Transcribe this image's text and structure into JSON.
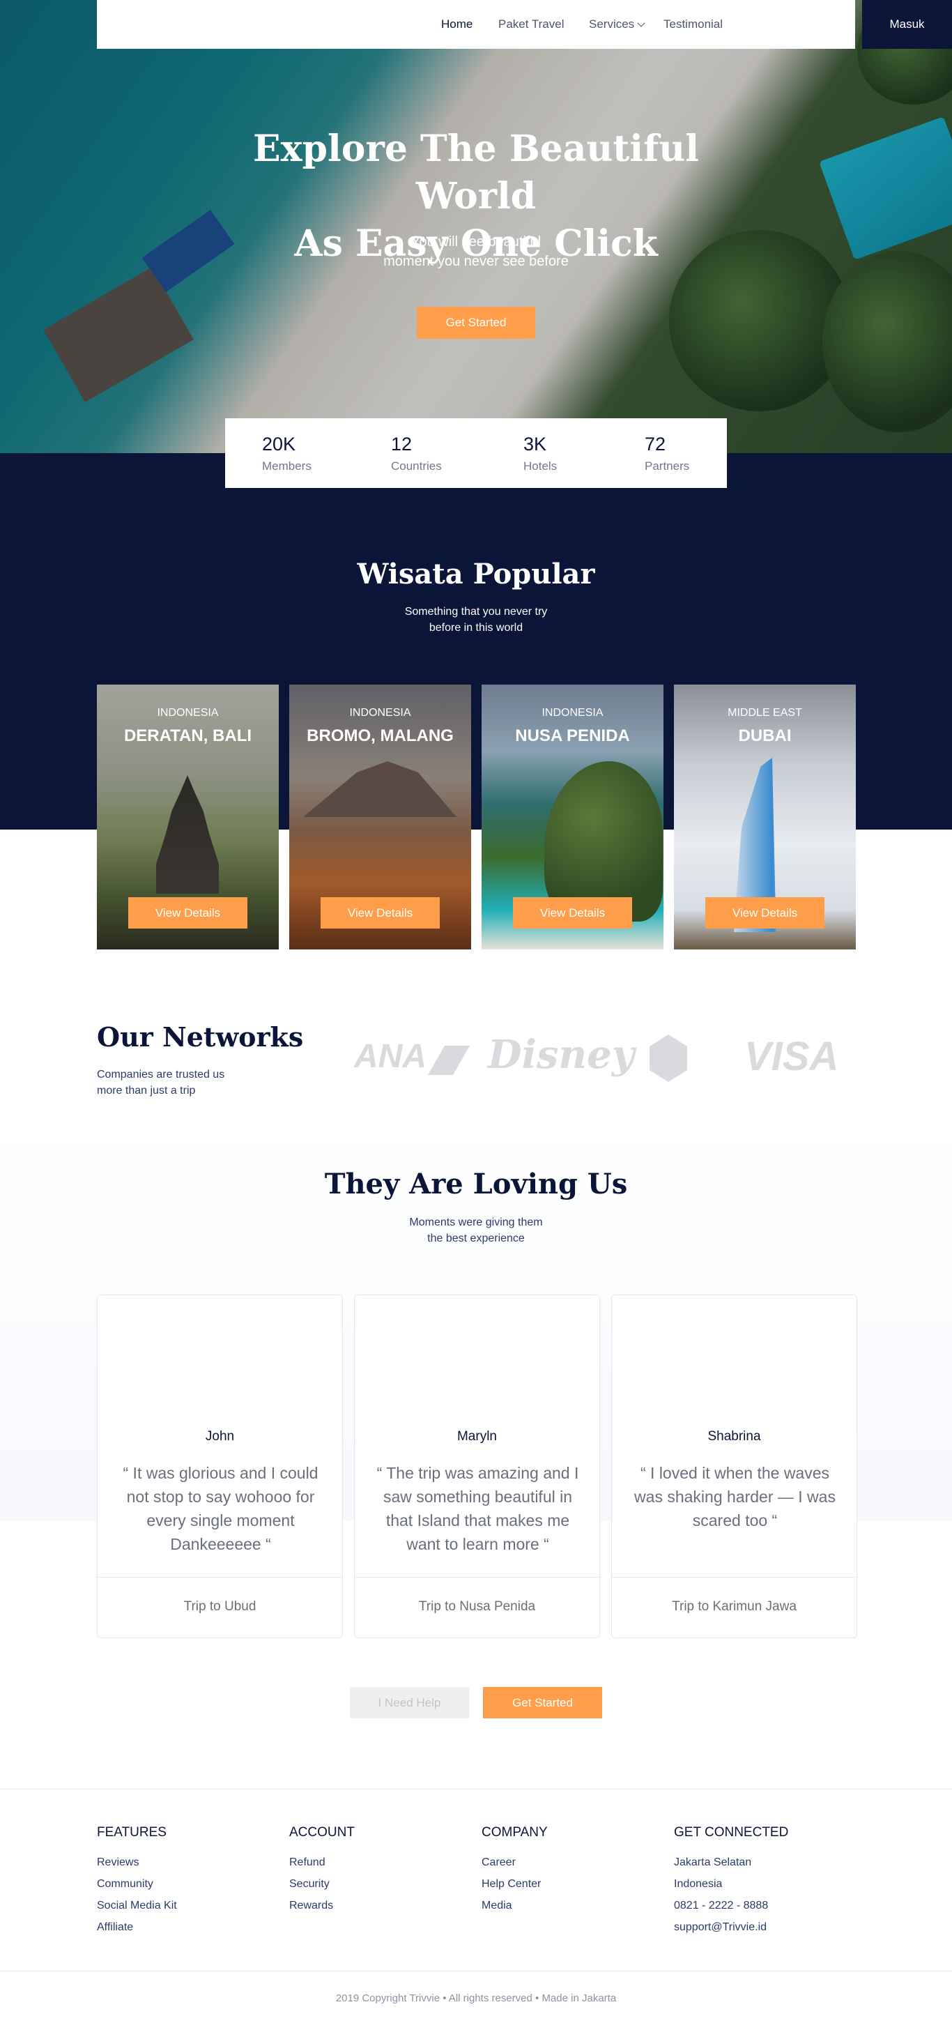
{
  "nav": {
    "items": [
      "Home",
      "Paket Travel",
      "Services",
      "Testimonial"
    ],
    "login_label": "Masuk"
  },
  "hero": {
    "title_line1": "Explore The Beautiful World",
    "title_line2": "As Easy One Click",
    "subtitle_line1": "You will see beautiful",
    "subtitle_line2": "moment you never see before",
    "cta_label": "Get Started"
  },
  "stats": [
    {
      "value": "20K",
      "label": "Members"
    },
    {
      "value": "12",
      "label": "Countries"
    },
    {
      "value": "3K",
      "label": "Hotels"
    },
    {
      "value": "72",
      "label": "Partners"
    }
  ],
  "popular": {
    "title": "Wisata Popular",
    "subtitle_line1": "Something that you never try",
    "subtitle_line2": "before in this world",
    "button_label": "View Details",
    "cards": [
      {
        "country": "INDONESIA",
        "place": "DERATAN, BALI"
      },
      {
        "country": "INDONESIA",
        "place": "BROMO, MALANG"
      },
      {
        "country": "INDONESIA",
        "place": "NUSA PENIDA"
      },
      {
        "country": "MIDDLE EAST",
        "place": "DUBAI"
      }
    ]
  },
  "networks": {
    "title": "Our Networks",
    "subtitle_line1": "Companies are trusted us",
    "subtitle_line2": "more than just a trip",
    "logos": [
      "ANA",
      "Disney",
      "VISA"
    ]
  },
  "testimonials": {
    "title": "They Are Loving Us",
    "subtitle_line1": "Moments were giving them",
    "subtitle_line2": "the best experience",
    "items": [
      {
        "name": "John",
        "quote": "“ It was glorious and I could not stop to say wohooo for every single moment Dankeeeeee “",
        "trip": "Trip to Ubud"
      },
      {
        "name": "Maryln",
        "quote": "“ The trip was amazing and I saw something beautiful in that Island that makes me want to learn more “",
        "trip": "Trip to Nusa Penida"
      },
      {
        "name": "Shabrina",
        "quote": "“ I loved it when the waves was shaking harder — I was scared too “",
        "trip": "Trip to Karimun Jawa"
      }
    ],
    "help_label": "I Need Help",
    "cta_label": "Get Started"
  },
  "footer": {
    "columns": [
      {
        "heading": "FEATURES",
        "links": [
          "Reviews",
          "Community",
          "Social Media Kit",
          "Affiliate"
        ]
      },
      {
        "heading": "ACCOUNT",
        "links": [
          "Refund",
          "Security",
          "Rewards"
        ]
      },
      {
        "heading": "COMPANY",
        "links": [
          "Career",
          "Help Center",
          "Media"
        ]
      },
      {
        "heading": "GET CONNECTED",
        "links": [
          "Jakarta Selatan",
          "Indonesia",
          "0821 - 2222 - 8888",
          "support@Trivvie.id"
        ]
      }
    ],
    "copyright": "2019 Copyright Trivvie • All rights reserved • Made in Jakarta"
  },
  "colors": {
    "navy": "#0b1538",
    "accent_orange": "#ff9e4a"
  }
}
